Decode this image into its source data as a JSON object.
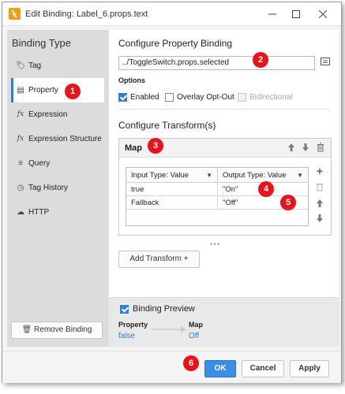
{
  "window": {
    "title": "Edit Binding: Label_6.props.text",
    "controls": [
      "minimize-icon",
      "maximize-icon",
      "close-icon"
    ]
  },
  "sidebar": {
    "title": "Binding Type",
    "items": [
      {
        "label": "Tag",
        "icon": "tag-icon",
        "glyph": "🏷",
        "active": false
      },
      {
        "label": "Property",
        "icon": "property-icon",
        "glyph": "▤",
        "active": true
      },
      {
        "label": "Expression",
        "icon": "function-icon",
        "glyph": "fx",
        "active": false
      },
      {
        "label": "Expression Structure",
        "icon": "function-icon",
        "glyph": "fx",
        "active": false
      },
      {
        "label": "Query",
        "icon": "database-icon",
        "glyph": "≡",
        "active": false
      },
      {
        "label": "Tag History",
        "icon": "clock-icon",
        "glyph": "◷",
        "active": false
      },
      {
        "label": "HTTP",
        "icon": "cloud-icon",
        "glyph": "☁",
        "active": false
      }
    ],
    "remove_label": "Remove Binding"
  },
  "property_binding": {
    "title": "Configure Property Binding",
    "path": "../ToggleSwitch.props.selected",
    "options_label": "Options",
    "options": [
      {
        "label": "Enabled",
        "checked": true,
        "disabled": false
      },
      {
        "label": "Overlay Opt-Out",
        "checked": false,
        "disabled": false
      },
      {
        "label": "Bidirectional",
        "checked": false,
        "disabled": true
      }
    ]
  },
  "transforms": {
    "title": "Configure Transform(s)",
    "map": {
      "title": "Map",
      "columns": [
        "Input Type: Value",
        "Output Type: Value"
      ],
      "rows": [
        {
          "input": "true",
          "output": "\"On\""
        },
        {
          "input": "Fallback",
          "output": "\"Off\""
        }
      ]
    },
    "add_label": "Add Transform +"
  },
  "preview": {
    "title": "Binding Preview",
    "checked": true,
    "from_label": "Property",
    "from_value": "false",
    "to_label": "Map",
    "to_value": "Off"
  },
  "buttons": {
    "ok": "OK",
    "cancel": "Cancel",
    "apply": "Apply"
  },
  "badges": [
    "1",
    "2",
    "3",
    "4",
    "5",
    "6"
  ],
  "colors": {
    "accent": "#2f7ed8",
    "badge": "#e8141b",
    "primary_button": "#3a8ee6"
  }
}
